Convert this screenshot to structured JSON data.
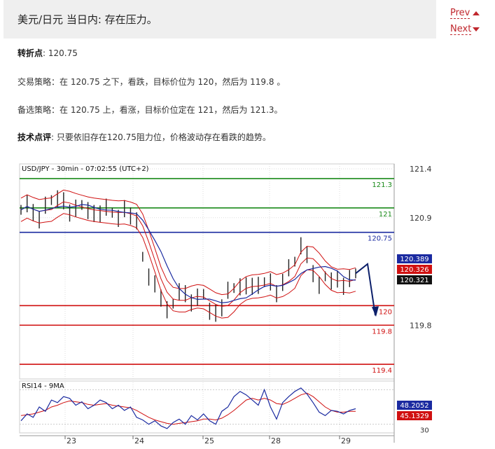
{
  "header": {
    "title": "美元/日元 当日内: 存在压力。"
  },
  "nav": {
    "prev_label": "Prev",
    "next_label": "Next"
  },
  "analysis": {
    "pivot_label": "转折点",
    "pivot_value": ": 120.75",
    "strategy_label": "交易策略：",
    "strategy_text": "在 120.75 之下，看跌，目标价位为 120，然后为 119.8 。",
    "alt_label": "备选策略：",
    "alt_text": "在 120.75 上，看涨，目标价位定在 121，然后为 121.3。",
    "comment_label": "技术点评",
    "comment_text": ": 只要依旧存在120.75阻力位，价格波动存在看跌的趋势。"
  },
  "chart_data": {
    "type": "line",
    "title": "USD/JPY - 30min - 07:02:55 (UTC+2)",
    "x_ticks": [
      "23",
      "24",
      "25",
      "28",
      "29"
    ],
    "y_ticks": [
      "121.4",
      "120.9",
      "119.8"
    ],
    "ylim": [
      119.25,
      121.45
    ],
    "levels": [
      {
        "value": 121.3,
        "label": "121.3",
        "color": "#1a8a1a"
      },
      {
        "value": 121.0,
        "label": "121",
        "color": "#1a8a1a"
      },
      {
        "value": 120.75,
        "label": "120.75",
        "color": "#1a2aa0"
      },
      {
        "value": 120.0,
        "label": "120",
        "color": "#d01010"
      },
      {
        "value": 119.8,
        "label": "119.8",
        "color": "#d01010"
      },
      {
        "value": 119.4,
        "label": "119.4",
        "color": "#d01010"
      }
    ],
    "price_tags": [
      {
        "value": "120.389",
        "color": "#1a2aa0"
      },
      {
        "value": "120.326",
        "color": "#d01010"
      },
      {
        "value": "120.321",
        "color": "#111111"
      }
    ],
    "price_series": [
      120.98,
      121.05,
      120.93,
      120.9,
      121.02,
      121.08,
      121.1,
      121.05,
      120.97,
      120.99,
      121.03,
      120.98,
      120.92,
      120.96,
      121.0,
      120.95,
      120.9,
      120.97,
      120.94,
      120.86,
      120.5,
      120.3,
      120.2,
      120.1,
      119.95,
      120.02,
      120.15,
      120.1,
      120.05,
      120.08,
      120.12,
      119.95,
      119.9,
      120.0,
      120.15,
      120.18,
      120.2,
      120.18,
      120.22,
      120.2,
      120.24,
      120.25,
      120.1,
      120.26,
      120.38,
      120.45,
      120.62,
      120.5,
      120.35,
      120.2,
      120.3,
      120.26,
      120.25,
      120.22,
      120.27,
      120.33
    ],
    "forecast": {
      "from": 120.33,
      "peak": 120.34,
      "target": 119.9
    },
    "rsi": {
      "label": "RSI14 - 9MA",
      "ticks": [
        "30"
      ],
      "ylim": [
        20,
        80
      ],
      "value_tag": "48.2052",
      "ma_tag": "45.1329",
      "rsi_series": [
        34,
        42,
        38,
        50,
        45,
        58,
        55,
        62,
        60,
        52,
        56,
        48,
        52,
        58,
        55,
        48,
        52,
        46,
        50,
        38,
        35,
        30,
        34,
        28,
        25,
        32,
        36,
        30,
        40,
        35,
        42,
        34,
        30,
        45,
        50,
        62,
        68,
        64,
        58,
        52,
        70,
        50,
        36,
        55,
        62,
        68,
        72,
        65,
        55,
        44,
        40,
        46,
        45,
        42,
        46,
        48
      ],
      "ma_series": [
        40,
        41,
        42,
        44,
        46,
        50,
        52,
        55,
        57,
        56,
        55,
        53,
        52,
        53,
        54,
        52,
        51,
        50,
        49,
        46,
        42,
        38,
        35,
        33,
        31,
        30,
        31,
        32,
        33,
        34,
        36,
        36,
        35,
        37,
        41,
        46,
        52,
        58,
        60,
        58,
        60,
        58,
        54,
        53,
        56,
        60,
        64,
        66,
        62,
        56,
        50,
        46,
        44,
        44,
        45,
        45
      ]
    }
  },
  "icons": {
    "prev": "triangle-up-icon",
    "next": "triangle-down-icon"
  }
}
